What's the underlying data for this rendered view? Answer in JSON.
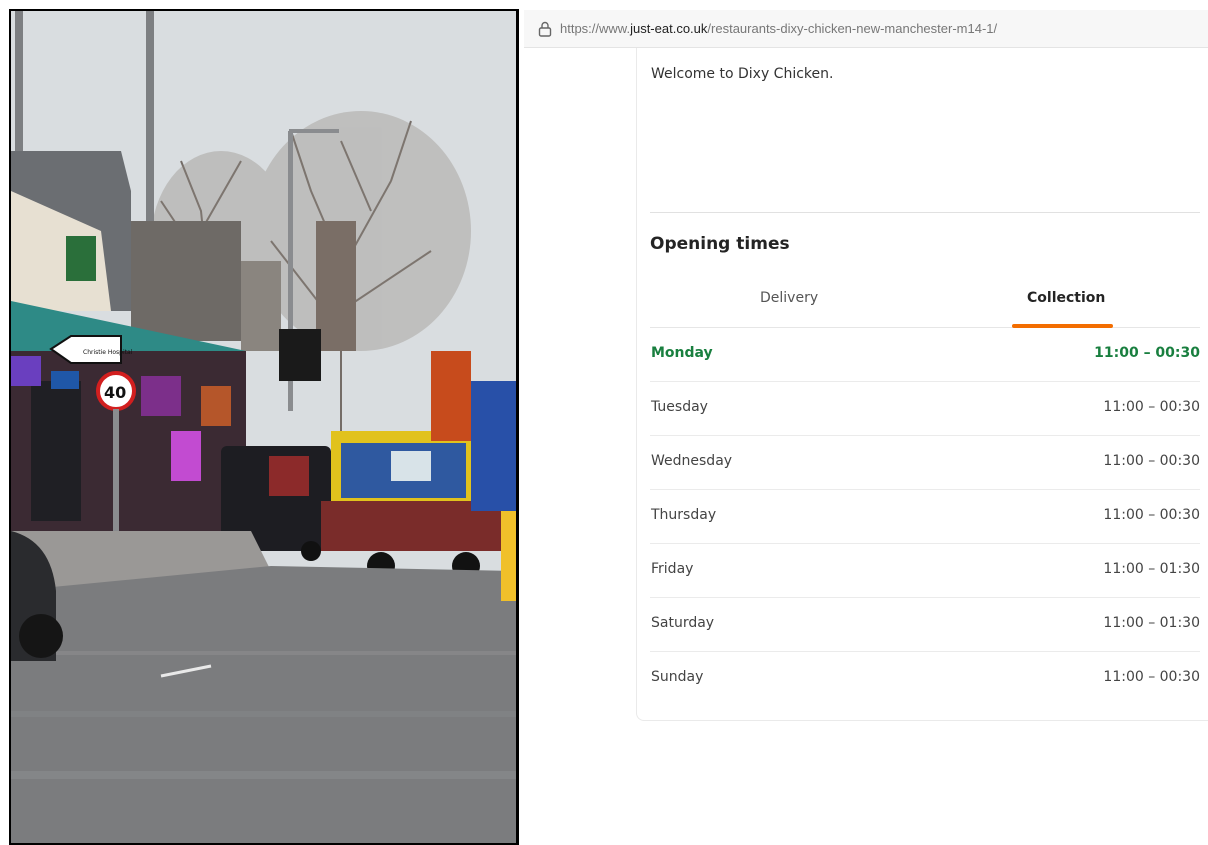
{
  "browser": {
    "url_prefix": "https://www.",
    "url_domain": "just-eat.co.uk",
    "url_path": "/restaurants-dixy-chicken-new-manchester-m14-1/"
  },
  "restaurant": {
    "welcome_text": "Welcome to Dixy Chicken."
  },
  "opening_times": {
    "title": "Opening times",
    "tabs": [
      {
        "label": "Delivery",
        "selected": false
      },
      {
        "label": "Collection",
        "selected": true
      }
    ],
    "rows": [
      {
        "day": "Monday",
        "hours": "11:00 – 00:30",
        "today": true
      },
      {
        "day": "Tuesday",
        "hours": "11:00 – 00:30",
        "today": false
      },
      {
        "day": "Wednesday",
        "hours": "11:00 – 00:30",
        "today": false
      },
      {
        "day": "Thursday",
        "hours": "11:00 – 00:30",
        "today": false
      },
      {
        "day": "Friday",
        "hours": "11:00 – 01:30",
        "today": false
      },
      {
        "day": "Saturday",
        "hours": "11:00 – 01:30",
        "today": false
      },
      {
        "day": "Sunday",
        "hours": "11:00 – 00:30",
        "today": false
      }
    ]
  },
  "photo": {
    "road_sign_text": "Christie Hospital",
    "speed_limit": "40"
  },
  "colors": {
    "accent_orange": "#f36d00",
    "today_green": "#197f3f",
    "shop_canopy": "#2e8a86"
  },
  "icons": [
    "lock-icon"
  ]
}
